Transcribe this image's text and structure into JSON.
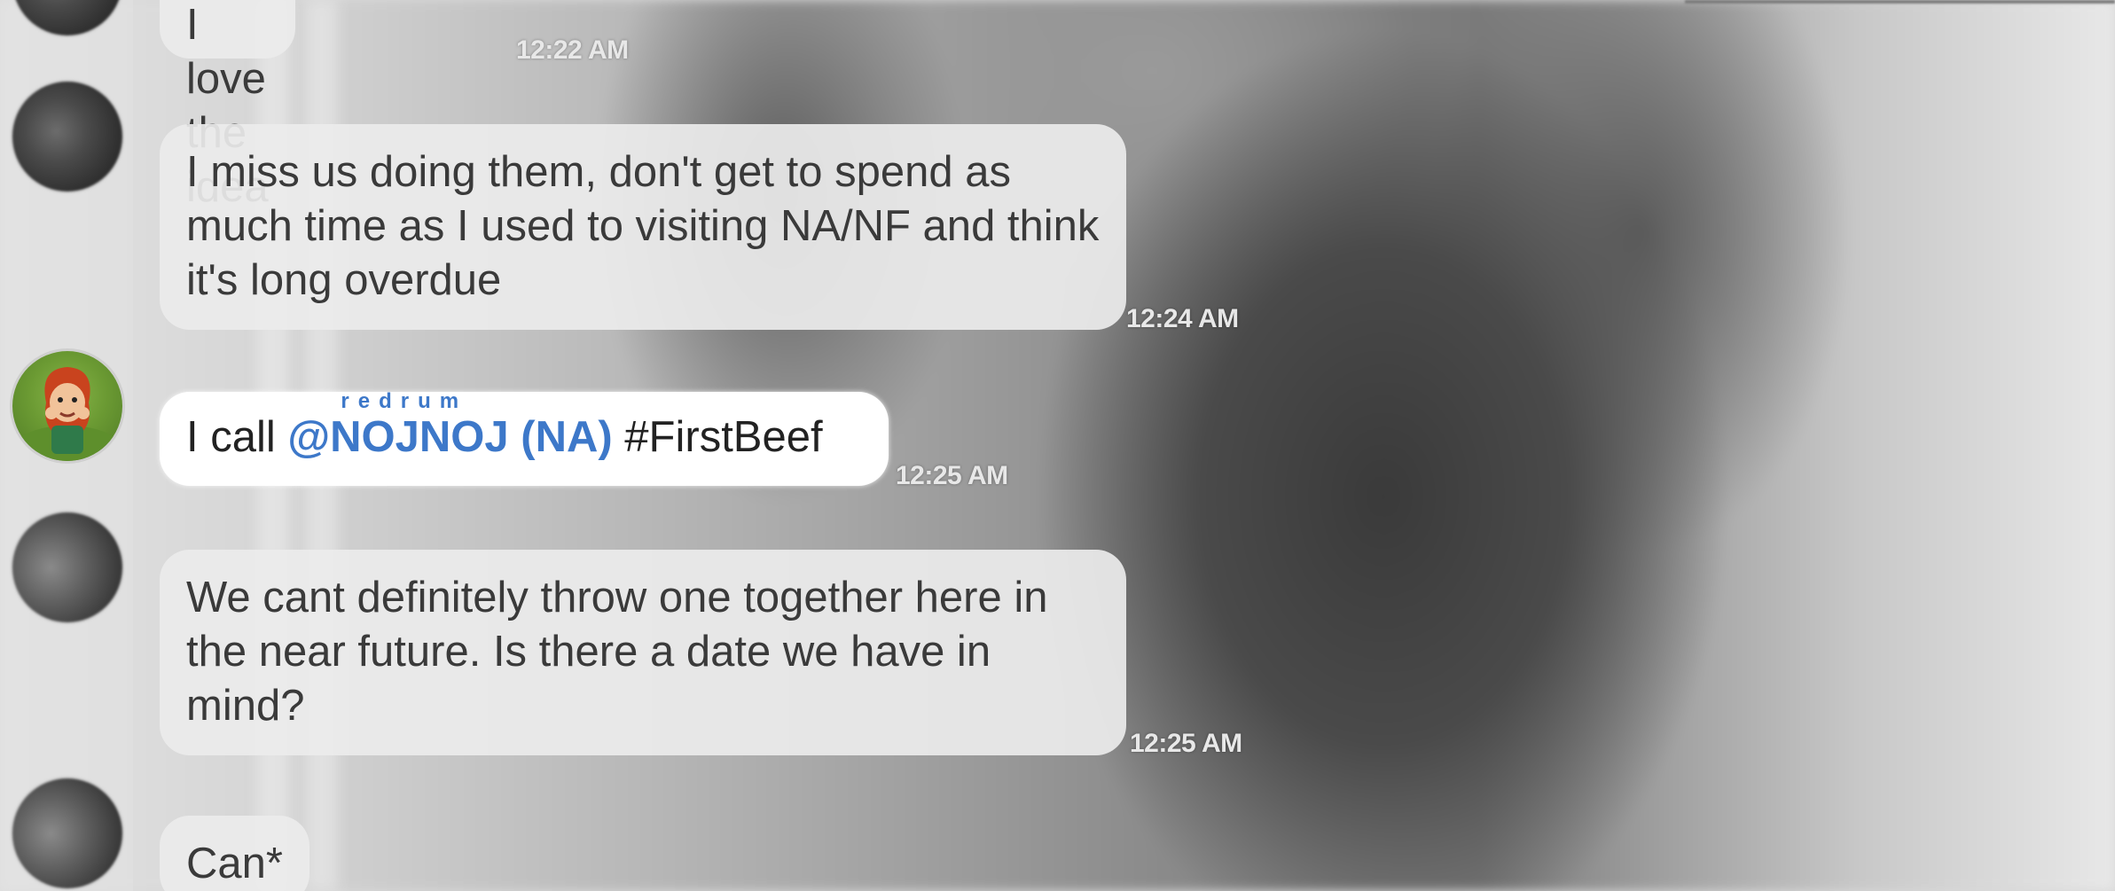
{
  "messages": [
    {
      "text": "I love the idea",
      "time": "12:22 AM"
    },
    {
      "text": "I miss us doing them,  don't get to spend as much time as I used to visiting NA/NF and think it's long overdue",
      "time": "12:24 AM"
    },
    {
      "prefix": "I call ",
      "mention": "@NOJNOJ (NA)",
      "mention_sub": "redrum",
      "hashtag": " #FirstBeef",
      "time": "12:25 AM"
    },
    {
      "text": "We cant definitely throw one together here in the near future. Is there a date we have in mind?",
      "time": "12:25 AM"
    },
    {
      "text": "Can*"
    }
  ],
  "colors": {
    "mention": "#3d78c9",
    "bubble": "#ececec",
    "bubble_highlight": "#ffffff",
    "timestamp": "#e8e8e8"
  },
  "icons": {
    "avatar_gray": "user-avatar",
    "avatar_color": "clash-character-avatar"
  }
}
